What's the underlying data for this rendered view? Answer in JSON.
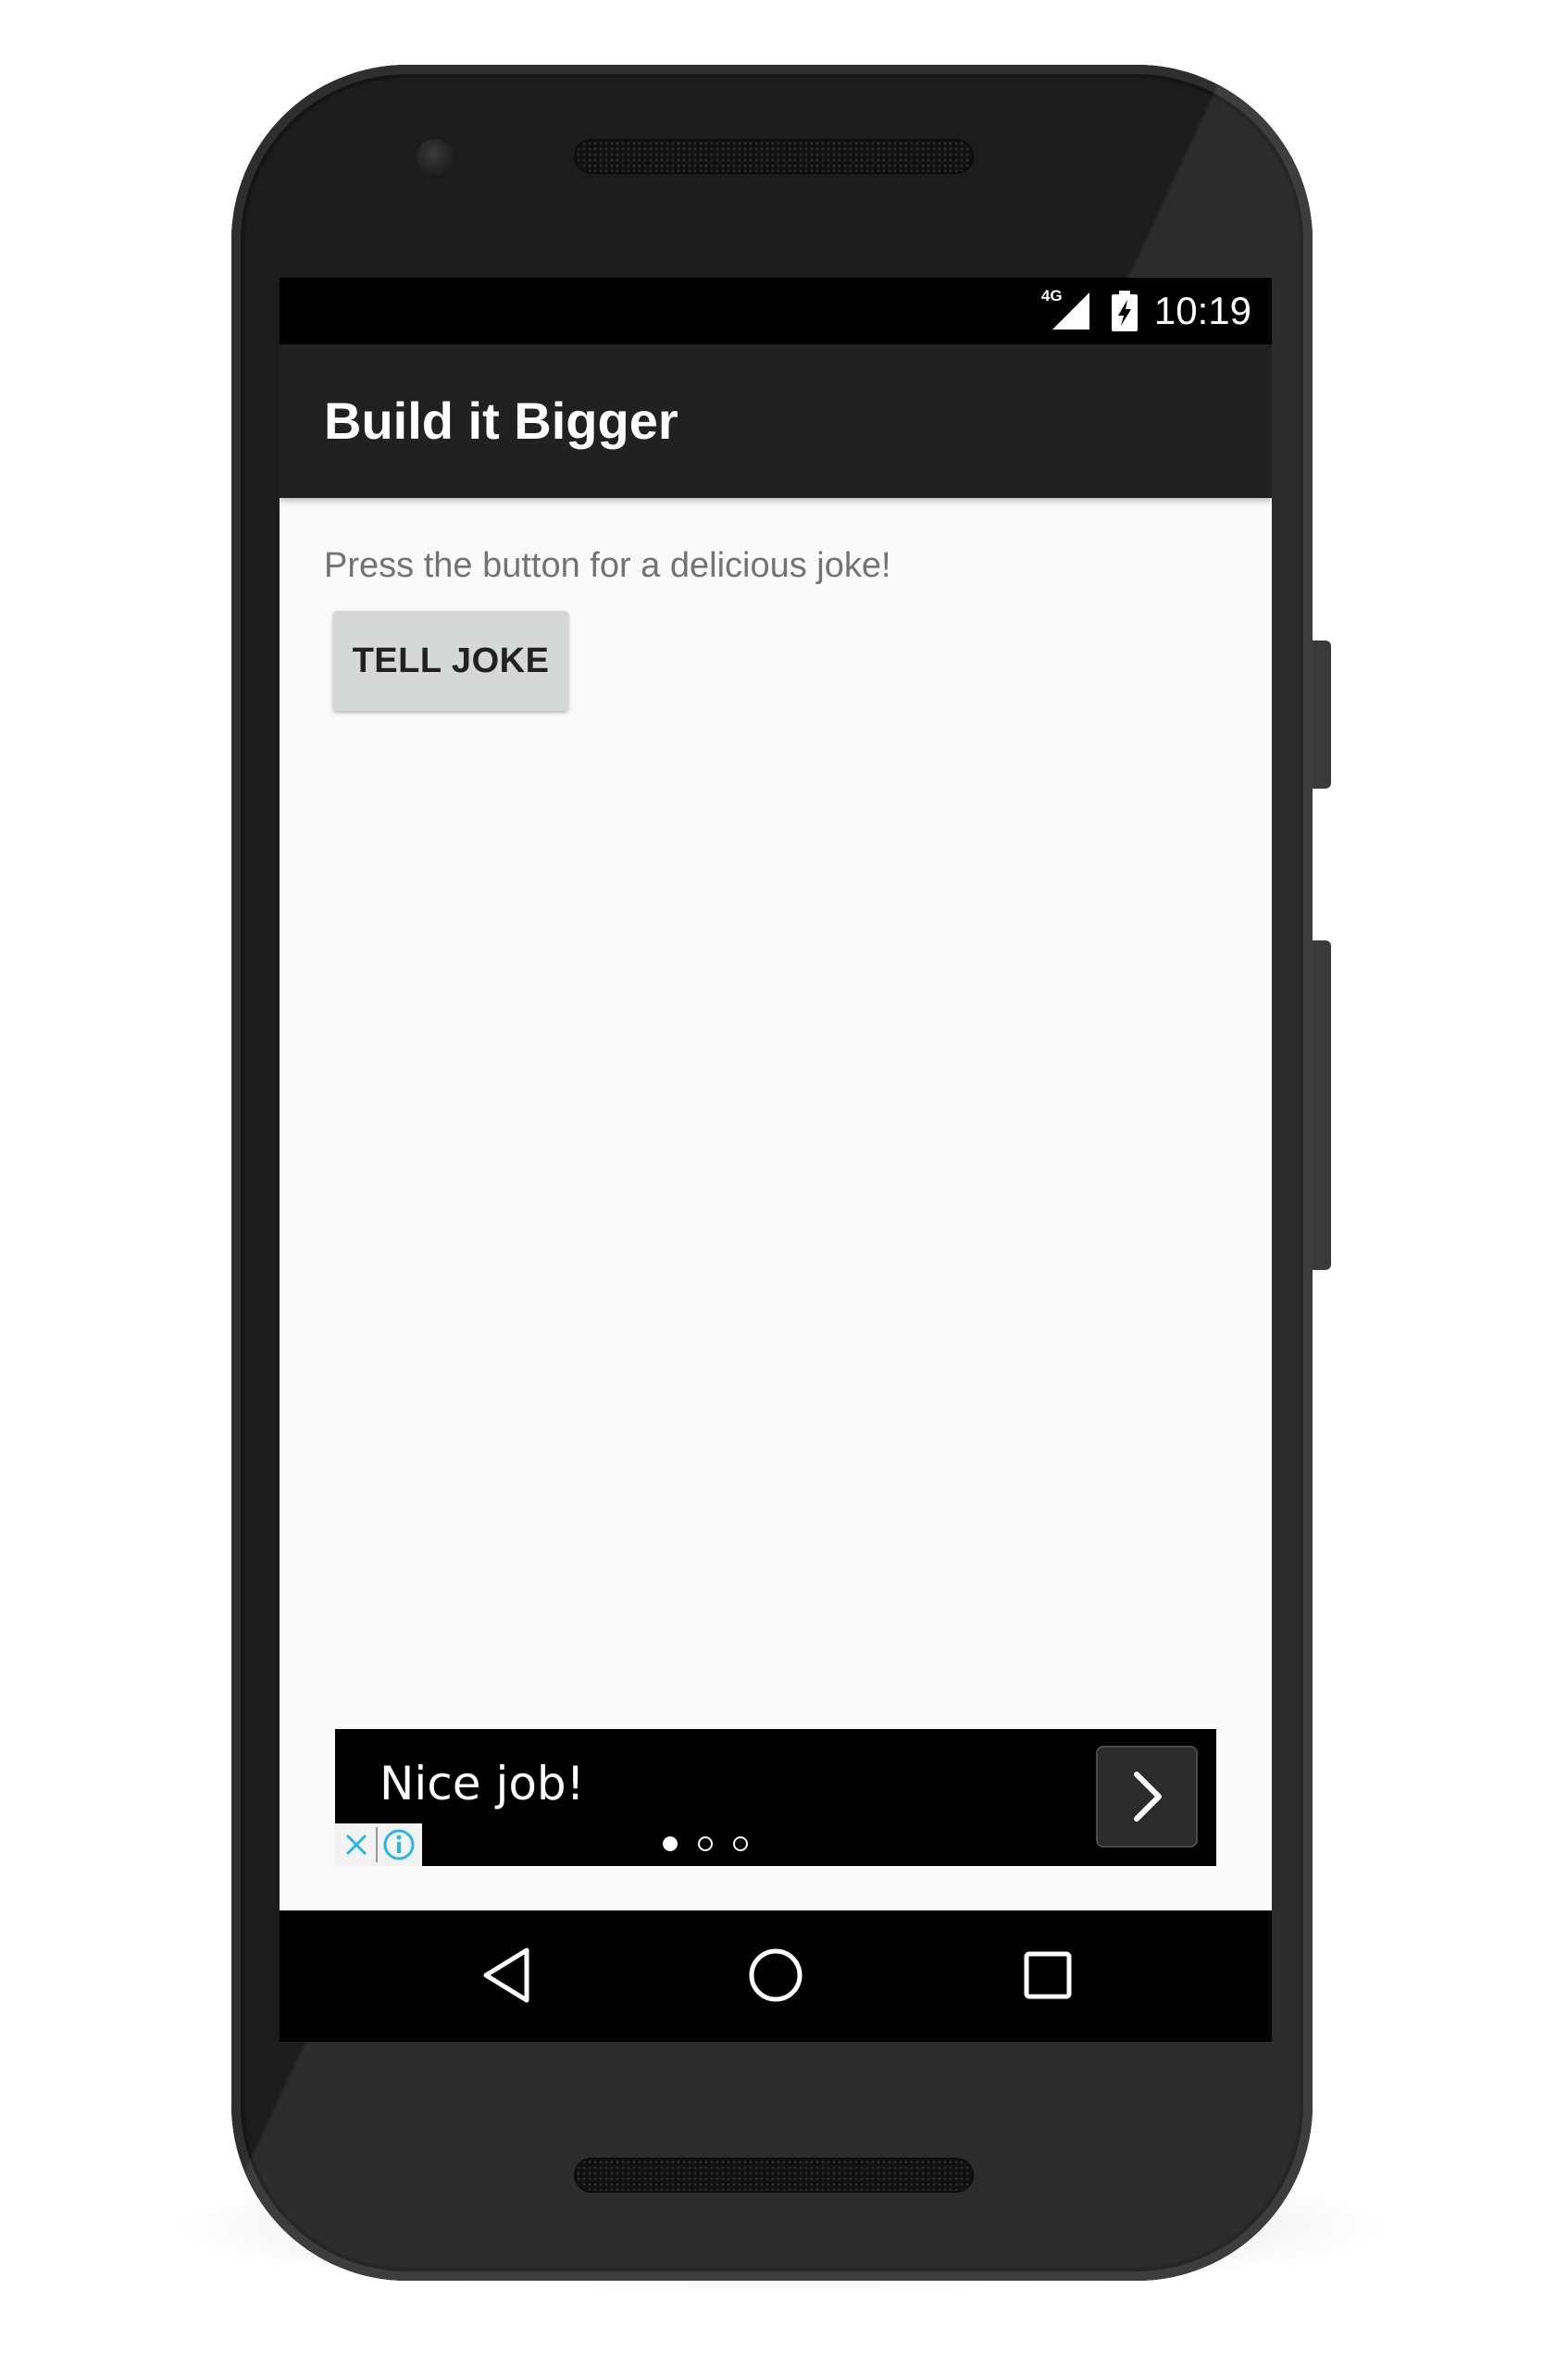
{
  "statusbar": {
    "network_type": "4G",
    "time": "10:19"
  },
  "appbar": {
    "title": "Build it Bigger"
  },
  "main": {
    "prompt": "Press the button for a delicious joke!",
    "tell_joke_label": "TELL JOKE"
  },
  "ad": {
    "headline": "Nice job!",
    "page_indicator": {
      "total": 3,
      "current": 1
    },
    "icons": [
      "close-icon",
      "info-icon",
      "chevron-right-icon"
    ]
  },
  "navbar": {
    "icons": [
      "back-icon",
      "home-icon",
      "recents-icon"
    ]
  },
  "colors": {
    "statusbar": "#000000",
    "appbar": "#212121",
    "screen_background": "#fafafa",
    "button": "#d6d7d7",
    "adchoices_accent": "#29b6e8"
  }
}
